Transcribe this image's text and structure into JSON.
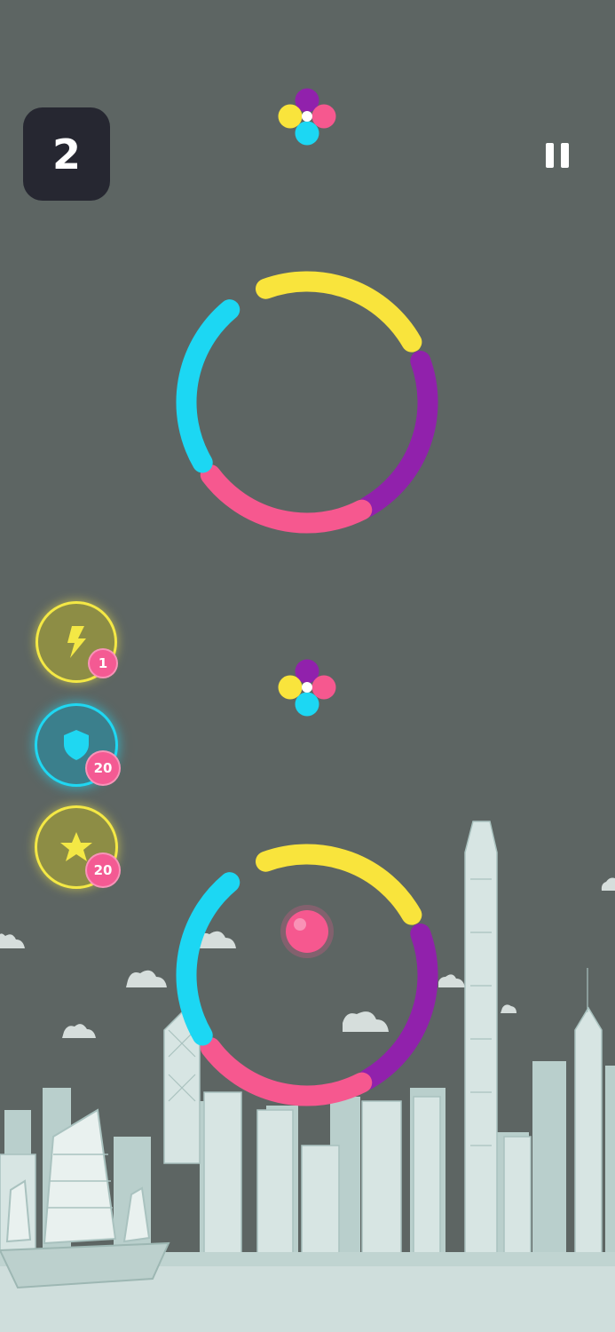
{
  "hud": {
    "score": "2",
    "pause_icon": "pause-icon"
  },
  "powerups": [
    {
      "name": "lightning",
      "icon": "lightning-icon",
      "count": "1",
      "ring_color": "#f4e845"
    },
    {
      "name": "shield",
      "icon": "shield-icon",
      "count": "20",
      "ring_color": "#1fd7f2"
    },
    {
      "name": "star",
      "icon": "star-icon",
      "count": "20",
      "ring_color": "#f4e845"
    }
  ],
  "colors": {
    "yellow": "#f9e43c",
    "purple": "#9121ac",
    "pink": "#f6588f",
    "cyan": "#1cd7f3",
    "background": "#5d6563",
    "player_ball": "#f6588f"
  },
  "obstacles": [
    {
      "type": "rotating-ring",
      "segments": [
        "yellow",
        "purple",
        "pink",
        "cyan"
      ]
    },
    {
      "type": "rotating-ring",
      "segments": [
        "yellow",
        "purple",
        "pink",
        "cyan"
      ]
    }
  ],
  "color_switchers": [
    {
      "petals": [
        "purple",
        "pink",
        "cyan",
        "yellow"
      ]
    },
    {
      "petals": [
        "purple",
        "pink",
        "cyan",
        "yellow"
      ]
    }
  ],
  "background_scene": "city-skyline-with-junk-boat"
}
